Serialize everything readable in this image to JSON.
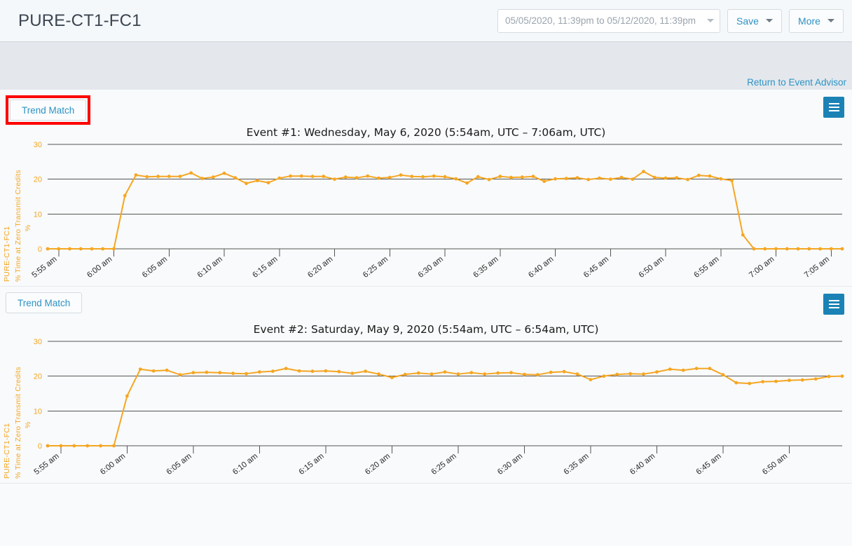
{
  "header": {
    "title": "PURE-CT1-FC1",
    "daterange": {
      "value": "05/05/2020, 11:39pm to 05/12/2020, 11:39pm",
      "icon": "chevron-down-icon"
    },
    "save_label": "Save",
    "more_label": "More"
  },
  "toolbar": {
    "return_link": "Return to Event Advisor"
  },
  "panels": [
    {
      "trend_match_label": "Trend Match",
      "menu_icon": "hamburger-menu-icon",
      "annotated": true
    },
    {
      "trend_match_label": "Trend Match",
      "menu_icon": "hamburger-menu-icon",
      "annotated": false
    }
  ],
  "colors": {
    "series": "#f5a623",
    "accent": "#2e92c4",
    "menu_button": "#1b82b5",
    "annotation": "#fd0000",
    "axis": "#555555",
    "plot_background": "#f8fafb"
  },
  "chart_data": [
    {
      "type": "line",
      "title": "Event #1: Wednesday, May 6, 2020 (5:54am, UTC – 7:06am, UTC)",
      "xlabel": "",
      "ylabel": "PURE-CT1-FC1 / % Time at Zero Transmit Credits / %",
      "ylabel_lines": [
        "PURE-CT1-FC1",
        "% Time at Zero Transmit Credits",
        "%"
      ],
      "series_name": "% Time at Zero Transmit Credits",
      "series_color": "#f5a623",
      "ylim": [
        0,
        30
      ],
      "yticks": [
        0,
        10,
        20,
        30
      ],
      "grid": true,
      "legend": "none",
      "xtick_labels": [
        "5:55 am",
        "6:00 am",
        "6:05 am",
        "6:10 am",
        "6:15 am",
        "6:20 am",
        "6:25 am",
        "6:30 am",
        "6:35 am",
        "6:40 am",
        "6:45 am",
        "6:50 am",
        "6:55 am",
        "7:00 am",
        "7:05 am"
      ],
      "xtick_minutes": [
        55,
        60,
        65,
        70,
        75,
        80,
        85,
        90,
        95,
        100,
        105,
        110,
        115,
        120,
        125
      ],
      "x_range_minutes": [
        54,
        126
      ],
      "x": [
        54,
        55,
        56,
        57,
        58,
        59,
        60,
        61,
        62,
        63,
        64,
        65,
        66,
        67,
        68,
        69,
        70,
        71,
        72,
        73,
        74,
        75,
        76,
        77,
        78,
        79,
        80,
        81,
        82,
        83,
        84,
        85,
        86,
        87,
        88,
        89,
        90,
        91,
        92,
        93,
        94,
        95,
        96,
        97,
        98,
        99,
        100,
        101,
        102,
        103,
        104,
        105,
        106,
        107,
        108,
        109,
        110,
        111,
        112,
        113,
        114,
        115,
        116,
        117,
        118,
        119,
        120,
        121,
        122,
        123,
        124,
        125,
        126
      ],
      "values": [
        0,
        0,
        0,
        0,
        0,
        0,
        0,
        15.3,
        21.2,
        20.7,
        20.8,
        20.8,
        20.8,
        21.8,
        20.2,
        20.6,
        21.7,
        20.4,
        18.8,
        19.6,
        19.0,
        20.3,
        20.9,
        20.9,
        20.8,
        20.8,
        20.0,
        20.6,
        20.4,
        20.9,
        20.3,
        20.5,
        21.2,
        20.8,
        20.7,
        20.9,
        20.7,
        20.1,
        18.9,
        20.7,
        19.9,
        20.8,
        20.5,
        20.6,
        20.8,
        19.4,
        20.1,
        20.2,
        20.4,
        19.9,
        20.3,
        20.0,
        20.5,
        20.0,
        22.2,
        20.5,
        20.3,
        20.4,
        19.9,
        21.1,
        20.9,
        20.1,
        19.6,
        4.0,
        0,
        0,
        0,
        0,
        0,
        0,
        0,
        0,
        0
      ]
    },
    {
      "type": "line",
      "title": "Event #2: Saturday, May 9, 2020 (5:54am, UTC – 6:54am, UTC)",
      "xlabel": "",
      "ylabel": "PURE-CT1-FC1 / % Time at Zero Transmit Credits / %",
      "ylabel_lines": [
        "PURE-CT1-FC1",
        "% Time at Zero Transmit Credits",
        "%"
      ],
      "series_name": "% Time at Zero Transmit Credits",
      "series_color": "#f5a623",
      "ylim": [
        0,
        30
      ],
      "yticks": [
        0,
        10,
        20,
        30
      ],
      "grid": true,
      "legend": "none",
      "xtick_labels": [
        "5:55 am",
        "6:00 am",
        "6:05 am",
        "6:10 am",
        "6:15 am",
        "6:20 am",
        "6:25 am",
        "6:30 am",
        "6:35 am",
        "6:40 am",
        "6:45 am",
        "6:50 am"
      ],
      "xtick_minutes": [
        55,
        60,
        65,
        70,
        75,
        80,
        85,
        90,
        95,
        100,
        105,
        110
      ],
      "x_range_minutes": [
        54,
        114
      ],
      "x": [
        54,
        55,
        56,
        57,
        58,
        59,
        60,
        61,
        62,
        63,
        64,
        65,
        66,
        67,
        68,
        69,
        70,
        71,
        72,
        73,
        74,
        75,
        76,
        77,
        78,
        79,
        80,
        81,
        82,
        83,
        84,
        85,
        86,
        87,
        88,
        89,
        90,
        91,
        92,
        93,
        94,
        95,
        96,
        97,
        98,
        99,
        100,
        101,
        102,
        103,
        104,
        105,
        106,
        107,
        108,
        109,
        110,
        111,
        112,
        113,
        114
      ],
      "values": [
        0,
        0,
        0,
        0,
        0,
        0,
        14.3,
        22.0,
        21.5,
        21.7,
        20.4,
        21.0,
        21.1,
        21.0,
        20.8,
        20.7,
        21.2,
        21.4,
        22.2,
        21.5,
        21.4,
        21.5,
        21.3,
        20.8,
        21.4,
        20.6,
        19.6,
        20.5,
        20.9,
        20.6,
        21.2,
        20.6,
        21.0,
        20.6,
        20.9,
        21.0,
        20.5,
        20.4,
        21.1,
        21.3,
        20.6,
        19.0,
        20.0,
        20.5,
        20.7,
        20.6,
        21.2,
        22.0,
        21.7,
        22.2,
        22.2,
        20.4,
        18.1,
        17.9,
        18.4,
        18.5,
        18.8,
        18.9,
        19.2,
        19.9,
        20.0
      ]
    }
  ]
}
